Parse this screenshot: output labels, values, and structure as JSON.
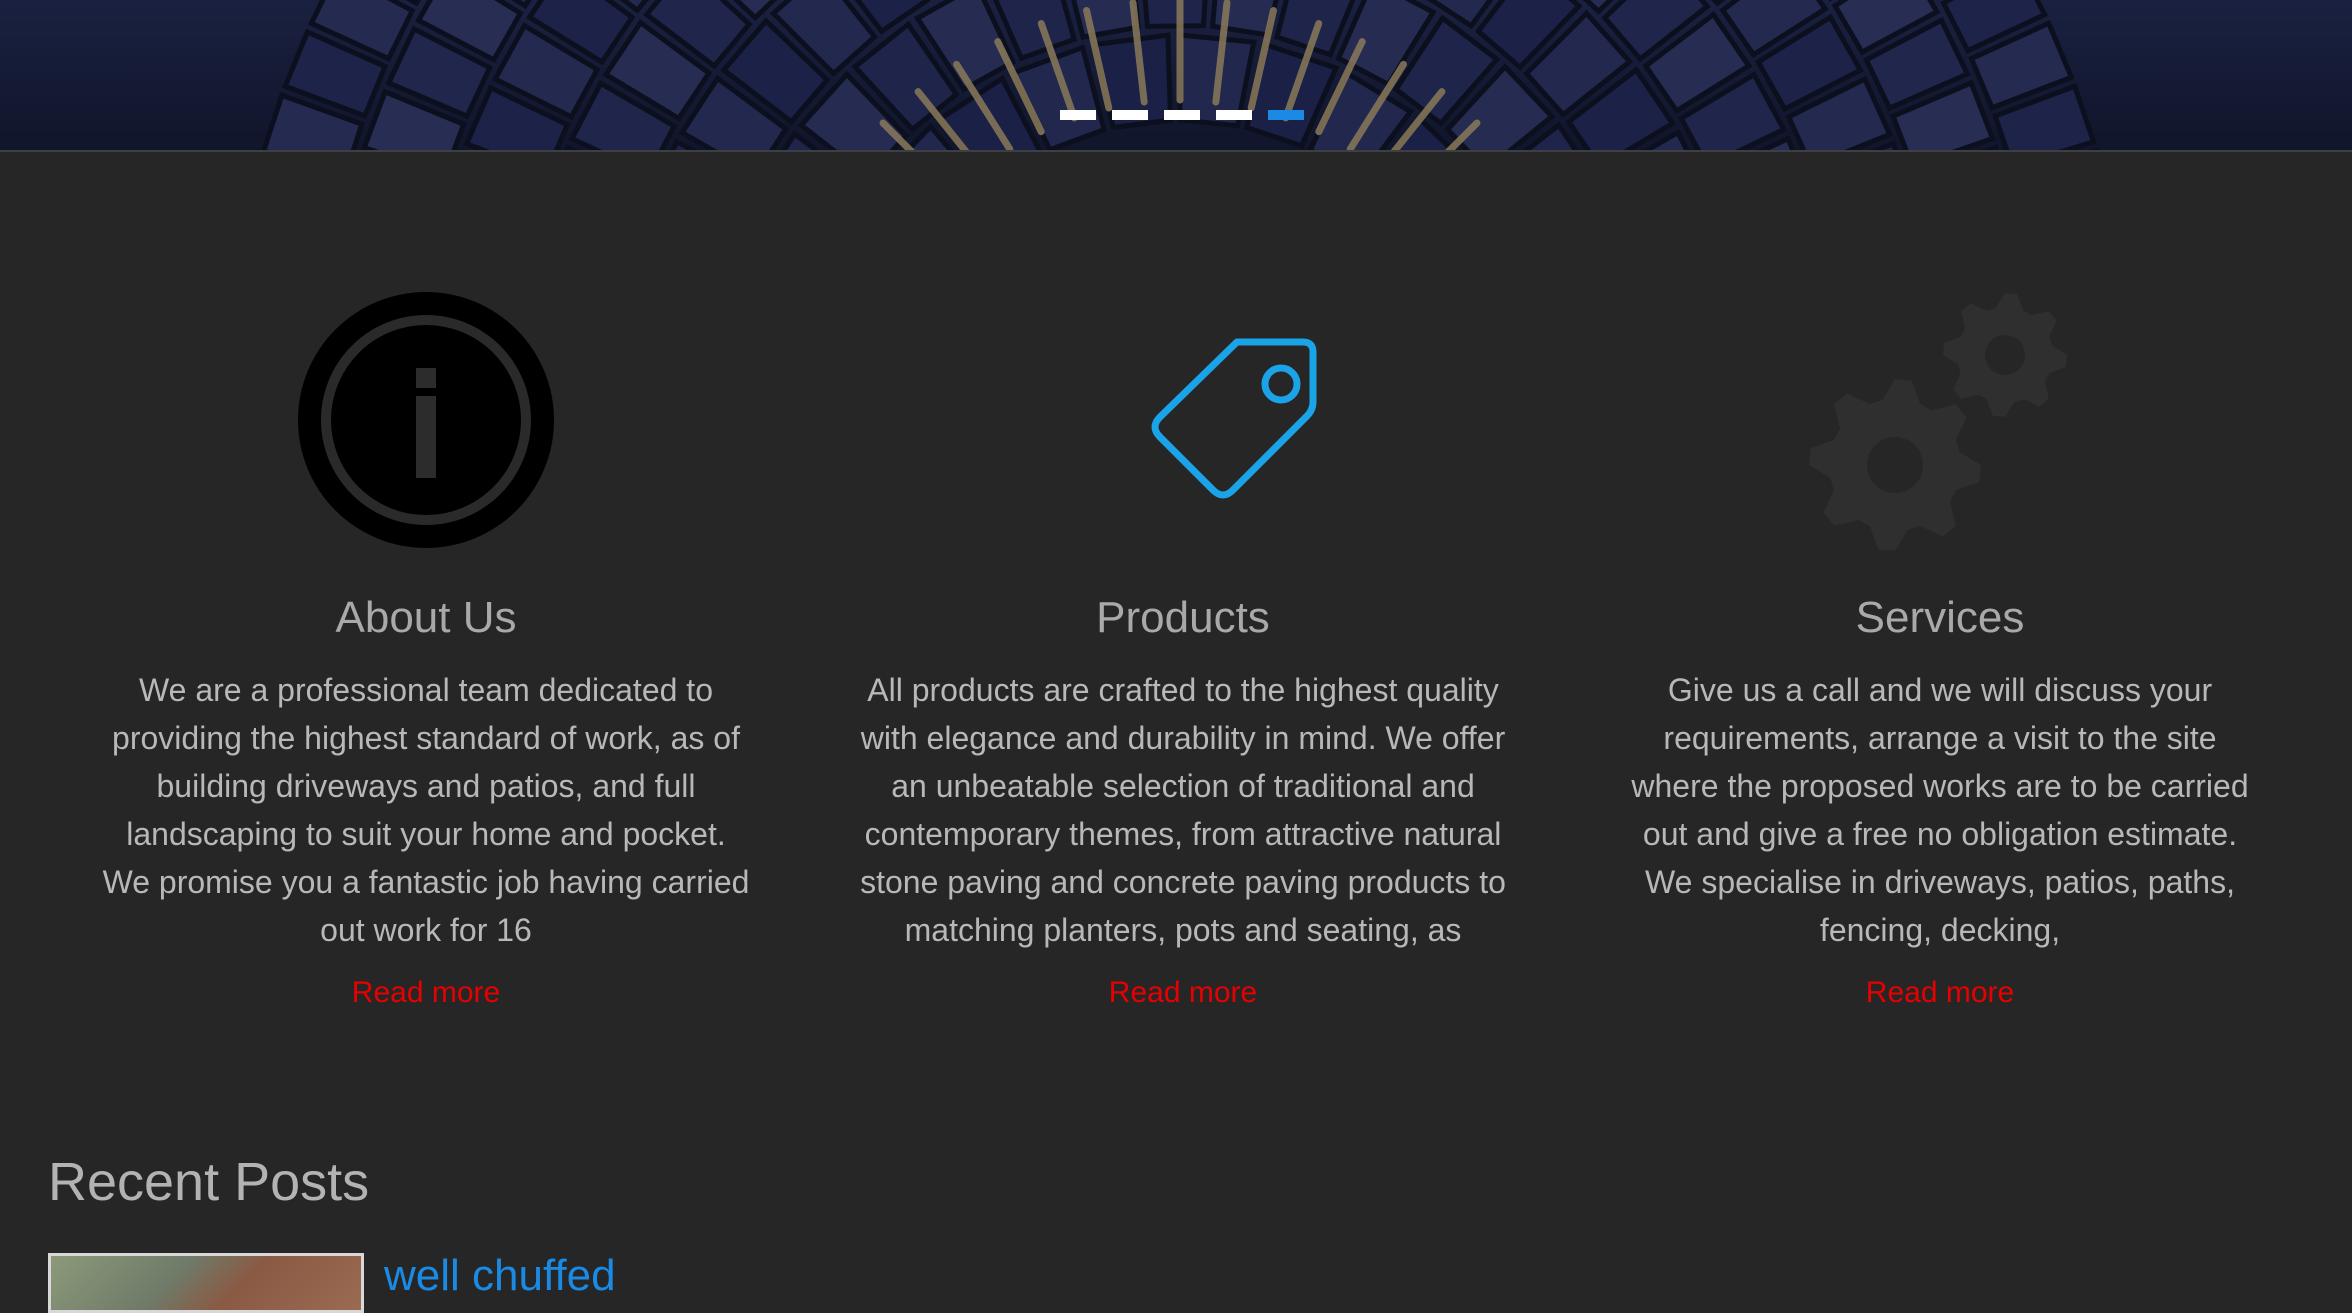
{
  "slider": {
    "dots": 5,
    "active_index": 4,
    "accent_color": "#1b8ae4"
  },
  "features": [
    {
      "icon": "info-icon",
      "title": "About Us",
      "text": "We are a professional team dedicated to providing the highest standard of work, as of building driveways and patios, and full landscaping to suit your home and pocket. We promise you a fantastic job having carried out work for 16",
      "link": "Read more"
    },
    {
      "icon": "price-tag-icon",
      "title": "Products",
      "text": "All products are crafted to the highest quality with elegance and durability in mind. We offer an unbeatable selection of traditional and contemporary themes, from attractive natural stone paving and concrete paving products to matching planters, pots and seating, as",
      "link": "Read more"
    },
    {
      "icon": "gears-icon",
      "title": "Services",
      "text": "Give us a call and we will discuss your requirements, arrange a visit to the site where the proposed works are to be carried out and give a free no obligation estimate. We specialise in driveways, patios, paths, fencing, decking,",
      "link": "Read more"
    }
  ],
  "recent_posts": {
    "heading": "Recent Posts",
    "items": [
      {
        "title": "well chuffed"
      }
    ]
  },
  "colors": {
    "background": "#262626",
    "link": "#e60000",
    "post_link": "#1b8ae4",
    "tag_icon": "#1aa3e6"
  }
}
